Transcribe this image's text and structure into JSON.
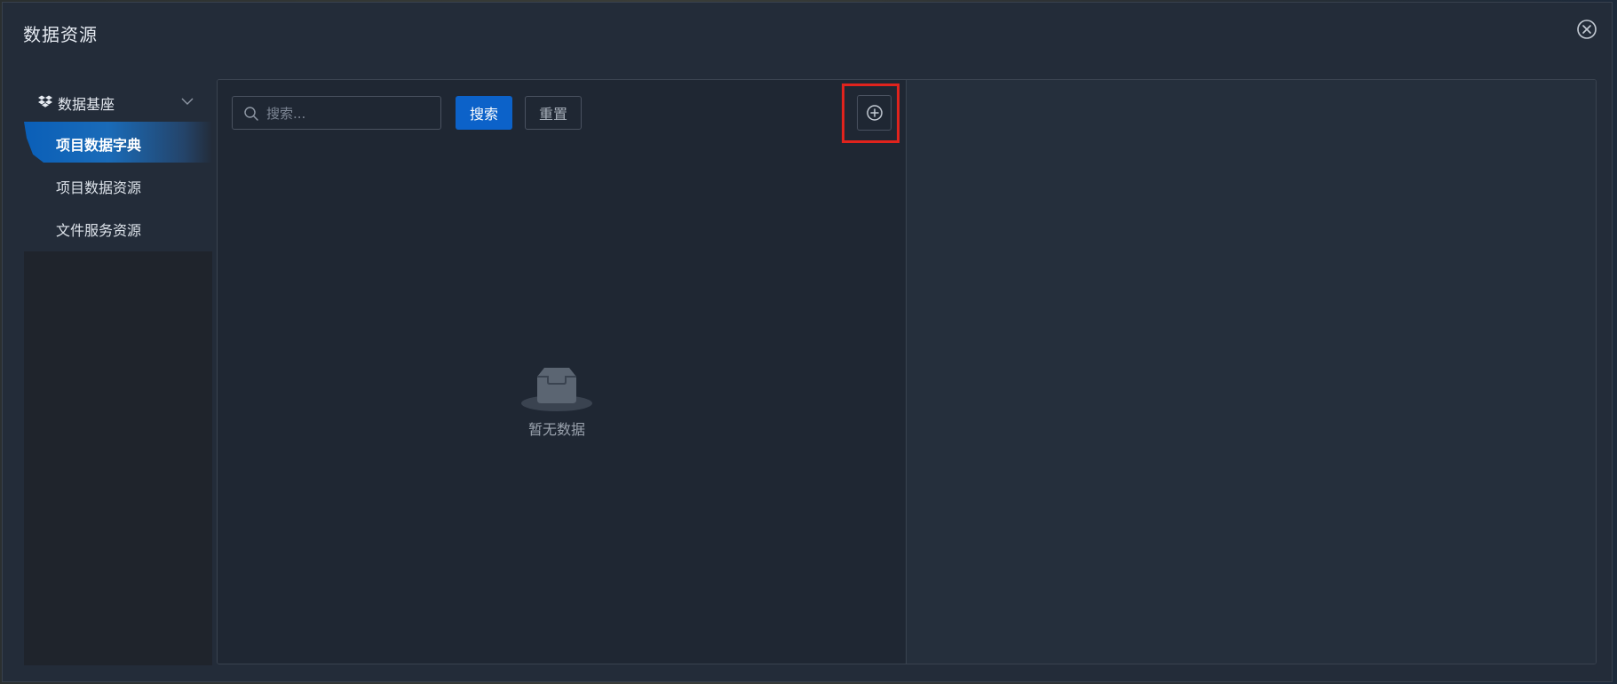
{
  "dialog": {
    "title": "数据资源",
    "close_icon": "close-circle-icon"
  },
  "sidebar": {
    "group": {
      "label": "数据基座",
      "icon": "dropbox-icon",
      "chevron": "chevron-down-icon"
    },
    "items": [
      {
        "label": "项目数据字典",
        "active": true
      },
      {
        "label": "项目数据资源",
        "active": false
      },
      {
        "label": "文件服务资源",
        "active": false
      }
    ]
  },
  "toolbar": {
    "search_placeholder": "搜索...",
    "search_value": "",
    "search_button": "搜索",
    "reset_button": "重置",
    "add_icon": "plus-circle-icon"
  },
  "empty_state": {
    "text": "暂无数据",
    "icon": "empty-inbox-icon"
  },
  "colors": {
    "accent": "#0c62c9",
    "highlight": "#e0231d",
    "panel": "#1f2733",
    "dialog": "#232c39"
  }
}
